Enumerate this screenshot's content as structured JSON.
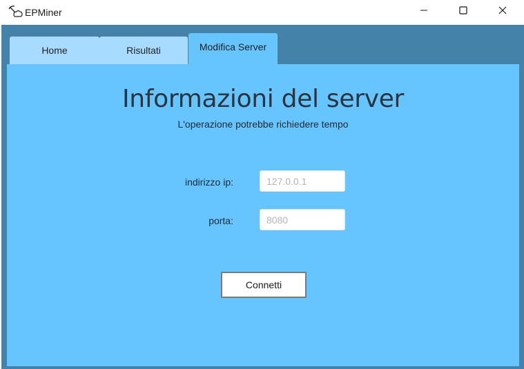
{
  "window": {
    "title": "EPMiner",
    "icon": "pickaxe-cloud-icon",
    "controls": [
      "minimize-icon",
      "maximize-icon",
      "close-icon"
    ]
  },
  "tabs": [
    {
      "label": "Home",
      "selected": false
    },
    {
      "label": "Risultati",
      "selected": false
    },
    {
      "label": "Modifica Server",
      "selected": true
    }
  ],
  "server_form": {
    "title": "Informazioni del server",
    "subtitle": "L'operazione potrebbe richiedere tempo",
    "ip_label": "indirizzo ip:",
    "ip_value": "",
    "ip_placeholder": "127.0.0.1",
    "port_label": "porta:",
    "port_value": "",
    "port_placeholder": "8080",
    "connect_label": "Connetti"
  },
  "colors": {
    "frame": "#4582aa",
    "panel": "#66c4ff",
    "tab_inactive": "#a7dbff"
  }
}
